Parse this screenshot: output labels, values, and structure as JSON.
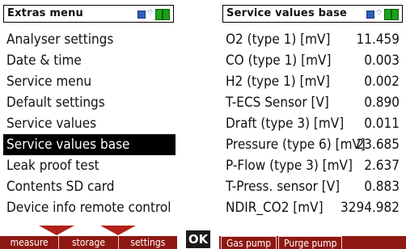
{
  "left_screen": {
    "title": "Extras menu",
    "menu": [
      {
        "label": "Analyser settings"
      },
      {
        "label": "Date & time"
      },
      {
        "label": "Service menu"
      },
      {
        "label": "Default settings"
      },
      {
        "label": "Service values"
      },
      {
        "label": "Service values base",
        "selected": true
      },
      {
        "label": "Leak proof test"
      },
      {
        "label": "Contents SD card"
      },
      {
        "label": "Device info remote control"
      }
    ],
    "softkeys": [
      "measure",
      "storage",
      "settings"
    ]
  },
  "ok_button": "OK",
  "right_screen": {
    "title": "Service values base",
    "rows": [
      {
        "label": "O2 (type 1) [mV]",
        "value": "11.459"
      },
      {
        "label": "CO (type 1) [mV]",
        "value": "0.003"
      },
      {
        "label": "H2 (type 1) [mV]",
        "value": "0.002"
      },
      {
        "label": "T-ECS Sensor [V]",
        "value": "0.890"
      },
      {
        "label": "Draft (type 3) [mV]",
        "value": "0.011"
      },
      {
        "label": "Pressure (type 6) [mV]",
        "value": "23.685"
      },
      {
        "label": "P-Flow (type 3) [mV]",
        "value": "2.637"
      },
      {
        "label": "T-Press. sensor [V]",
        "value": "0.883"
      },
      {
        "label": "NDIR_CO2 [mV]",
        "value": "3294.982"
      }
    ],
    "softkeys": [
      "Gas pump",
      "Purge pump"
    ]
  },
  "colors": {
    "softbar": "#8e1812",
    "arrow": "#b1211a",
    "status_green": "#1aa21a",
    "status_blue": "#2f5fb8"
  },
  "icons": [
    "battery-icon",
    "wireless-icon",
    "status-green-icon"
  ]
}
